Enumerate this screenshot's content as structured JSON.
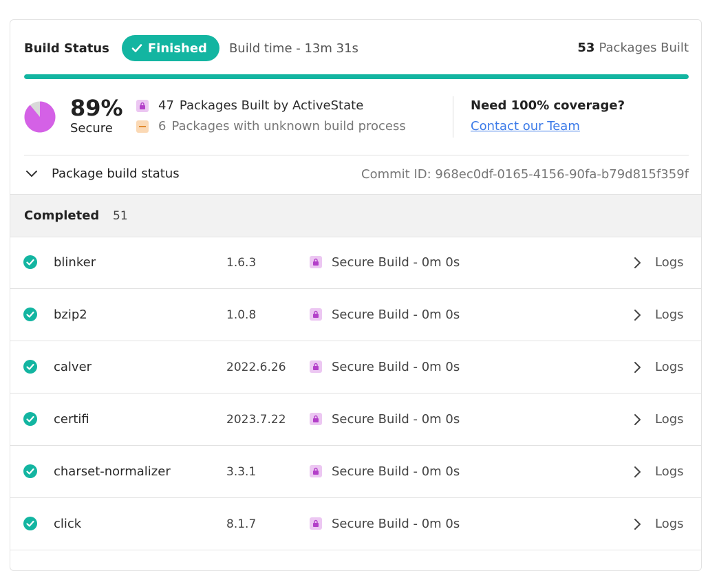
{
  "header": {
    "title": "Build Status",
    "status_label": "Finished",
    "build_time": "Build time - 13m 31s",
    "packages_built_count": "53",
    "packages_built_label": "Packages Built",
    "progress_fraction": 1.0
  },
  "summary": {
    "secure_percent": "89%",
    "secure_label": "Secure",
    "secure_fraction": 0.89,
    "built_by_activestate_count": "47",
    "built_by_activestate_label": "Packages Built by ActiveState",
    "unknown_count": "6",
    "unknown_label": "Packages with unknown build process",
    "coverage_title": "Need 100% coverage?",
    "contact_link": "Contact our Team"
  },
  "section": {
    "toggle_label": "Package build status",
    "commit_id": "Commit ID: 968ec0df-0165-4156-90fa-b79d815f359f"
  },
  "completed": {
    "label": "Completed",
    "count": "51"
  },
  "packages": [
    {
      "name": "blinker",
      "version": "1.6.3",
      "build": "Secure Build - 0m 0s",
      "logs": "Logs"
    },
    {
      "name": "bzip2",
      "version": "1.0.8",
      "build": "Secure Build - 0m 0s",
      "logs": "Logs"
    },
    {
      "name": "calver",
      "version": "2022.6.26",
      "build": "Secure Build - 0m 0s",
      "logs": "Logs"
    },
    {
      "name": "certifi",
      "version": "2023.7.22",
      "build": "Secure Build - 0m 0s",
      "logs": "Logs"
    },
    {
      "name": "charset-normalizer",
      "version": "3.3.1",
      "build": "Secure Build - 0m 0s",
      "logs": "Logs"
    },
    {
      "name": "click",
      "version": "8.1.7",
      "build": "Secure Build - 0m 0s",
      "logs": "Logs"
    }
  ],
  "colors": {
    "accent_teal": "#13b5a1",
    "secure_purple": "#d461e6",
    "unknown_orange": "#fbd9b5",
    "link_blue": "#3b7ae8"
  },
  "icons": {
    "badge": "check-icon",
    "secure": "lock-icon",
    "unknown": "minus-icon",
    "row_status": "check-circle-icon",
    "logs": "chevron-right-icon",
    "toggle": "chevron-down-icon"
  }
}
